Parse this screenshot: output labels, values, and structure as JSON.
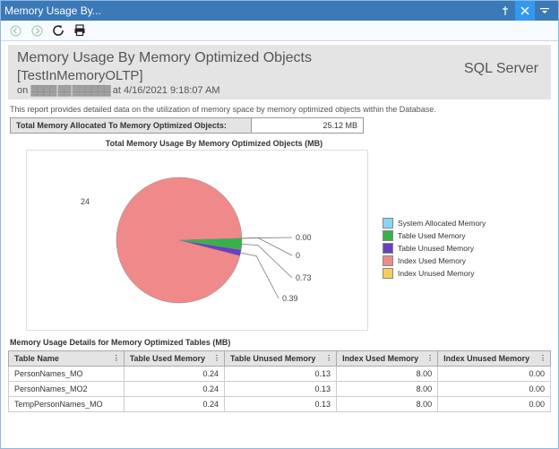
{
  "window": {
    "title": "Memory Usage By..."
  },
  "header": {
    "title": "Memory Usage By Memory Optimized Objects",
    "subtitle": "[TestInMemoryOLTP]",
    "on_prefix": "on",
    "host_blur": "▓▓▓▓  ▓▓   ▓▓▓▓▓▓",
    "at": "at 4/16/2021 9:18:07 AM",
    "product": "SQL Server"
  },
  "description": "This report provides detailed data on the utilization of memory space by memory optimized objects within the Database.",
  "allocated": {
    "label": "Total Memory Allocated To Memory Optimized Objects:",
    "value": "25.12 MB"
  },
  "chart": {
    "title": "Total Memory Usage By Memory Optimized Objects (MB)"
  },
  "chart_data": {
    "type": "pie",
    "title": "Total Memory Usage By Memory Optimized Objects (MB)",
    "series": [
      {
        "name": "System Allocated Memory",
        "value": 0.0,
        "color": "#8ad6f2"
      },
      {
        "name": "Table Used Memory",
        "value": 0.73,
        "color": "#35b24a"
      },
      {
        "name": "Table Unused Memory",
        "value": 0.39,
        "color": "#6a3fbf"
      },
      {
        "name": "Index Used Memory",
        "value": 24,
        "color": "#f08a8a"
      },
      {
        "name": "Index Unused Memory",
        "value": 0,
        "color": "#f5cf5a"
      }
    ],
    "labels": [
      "0.00",
      "0",
      "0.73",
      "0.39",
      "24"
    ]
  },
  "legend": [
    {
      "label": "System Allocated Memory",
      "color": "#8ad6f2"
    },
    {
      "label": "Table Used Memory",
      "color": "#35b24a"
    },
    {
      "label": "Table Unused Memory",
      "color": "#6a3fbf"
    },
    {
      "label": "Index Used Memory",
      "color": "#f08a8a"
    },
    {
      "label": "Index Unused Memory",
      "color": "#f5cf5a"
    }
  ],
  "details": {
    "title": "Memory Usage Details for Memory Optimized Tables (MB)",
    "columns": [
      "Table Name",
      "Table Used Memory",
      "Table Unused Memory",
      "Index Used Memory",
      "Index Unused Memory"
    ],
    "rows": [
      {
        "c0": "PersonNames_MO",
        "c1": "0.24",
        "c2": "0.13",
        "c3": "8.00",
        "c4": "0.00"
      },
      {
        "c0": "PersonNames_MO2",
        "c1": "0.24",
        "c2": "0.13",
        "c3": "8.00",
        "c4": "0.00"
      },
      {
        "c0": "TempPersonNames_MO",
        "c1": "0.24",
        "c2": "0.13",
        "c3": "8.00",
        "c4": "0.00"
      }
    ]
  }
}
